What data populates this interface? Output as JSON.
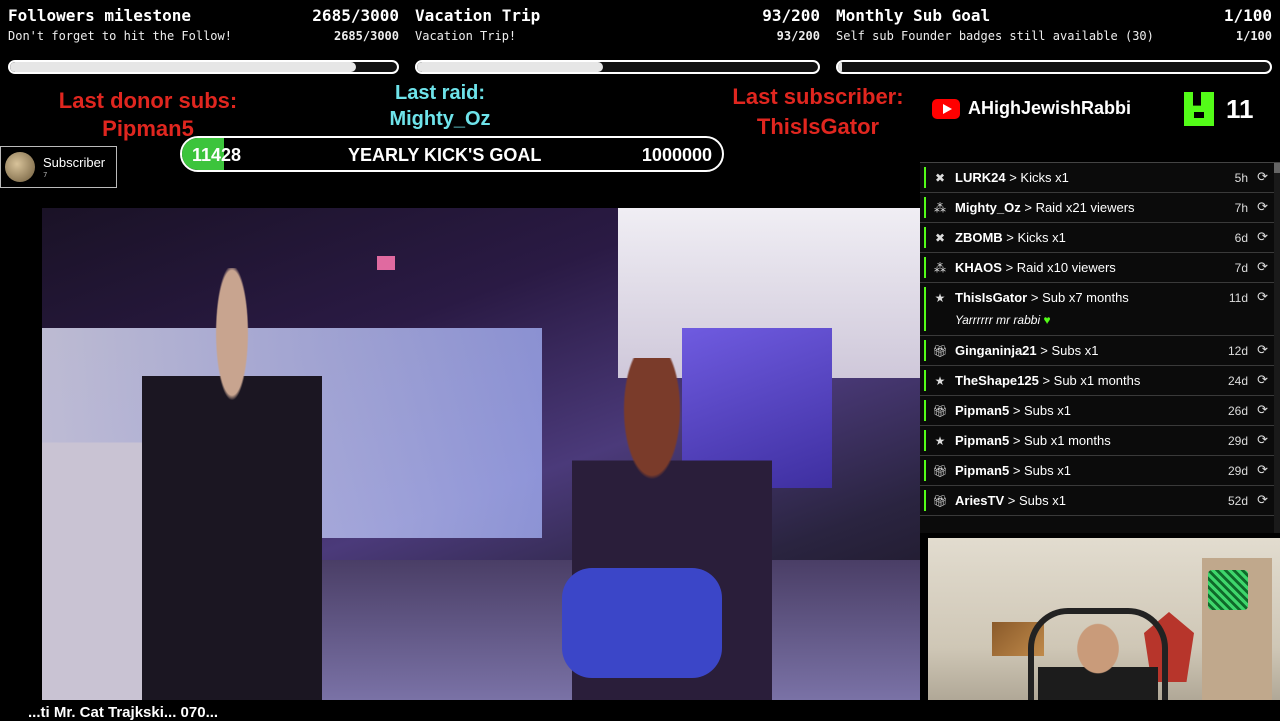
{
  "goals": [
    {
      "title": "Followers milestone",
      "count": "2685/3000",
      "subtitle": "Don't forget to hit the Follow!",
      "subcount": "2685/3000",
      "progress": 0.895
    },
    {
      "title": "Vacation Trip",
      "count": "93/200",
      "subtitle": "Vacation Trip!",
      "subcount": "93/200",
      "progress": 0.465
    },
    {
      "title": "Monthly Sub Goal",
      "count": "1/100",
      "subtitle": "Self sub Founder badges still available (30)",
      "subcount": "1/100",
      "progress": 0.01
    }
  ],
  "last_donor": {
    "label": "Last donor subs:",
    "name": "Pipman5"
  },
  "last_raid": {
    "label": "Last raid:",
    "name": "Mighty_Oz"
  },
  "last_subscriber": {
    "label": "Last subscriber:",
    "name": "ThisIsGator"
  },
  "kick_goal": {
    "current": "11428",
    "label": "YEARLY KICK'S GOAL",
    "target": "1000000",
    "progress": 0.011428
  },
  "subscriber_badge": {
    "label": "Subscriber",
    "count": "7"
  },
  "youtube": {
    "icon": "youtube-icon",
    "name": "AHighJewishRabbi"
  },
  "kick": {
    "icon": "kick-logo-icon",
    "count": "11"
  },
  "events": [
    {
      "icon": "kick-icon",
      "user": "LURK24",
      "action": "> Kicks x1",
      "age": "5h"
    },
    {
      "icon": "raid-icon",
      "user": "Mighty_Oz",
      "action": "> Raid x21 viewers",
      "age": "7h"
    },
    {
      "icon": "kick-icon",
      "user": "ZBOMB",
      "action": "> Kicks x1",
      "age": "6d"
    },
    {
      "icon": "raid-icon",
      "user": "KHAOS",
      "action": "> Raid x10 viewers",
      "age": "7d"
    },
    {
      "icon": "star-icon",
      "user": "ThisIsGator",
      "action": "> Sub x7 months",
      "age": "11d",
      "message": "Yarrrrrr mr rabbi",
      "message_emoji": "♥"
    },
    {
      "icon": "gift-icon",
      "user": "Ginganinja21",
      "action": "> Subs x1",
      "age": "12d"
    },
    {
      "icon": "star-icon",
      "user": "TheShape125",
      "action": "> Sub x1 months",
      "age": "24d"
    },
    {
      "icon": "gift-icon",
      "user": "Pipman5",
      "action": "> Subs x1",
      "age": "26d"
    },
    {
      "icon": "star-icon",
      "user": "Pipman5",
      "action": "> Sub x1 months",
      "age": "29d"
    },
    {
      "icon": "gift-icon",
      "user": "Pipman5",
      "action": "> Subs x1",
      "age": "29d"
    },
    {
      "icon": "gift-icon",
      "user": "AriesTV",
      "action": "> Subs x1",
      "age": "52d"
    }
  ],
  "ticker": {
    "text": "...ti Mr. Cat Trajkski... 070..."
  }
}
